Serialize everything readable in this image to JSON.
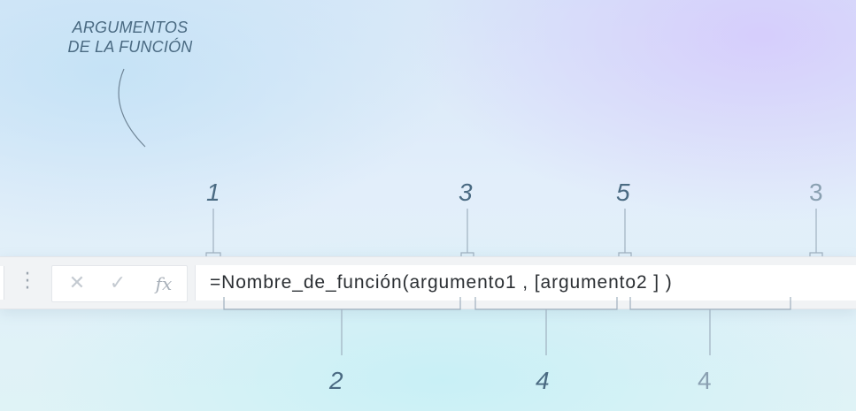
{
  "heading": {
    "line1": "ARGUMENTOS",
    "line2": "DE LA FUNCIÓN"
  },
  "formula_bar": {
    "cancel_icon": "close-icon",
    "cancel_glyph": "✕",
    "enter_icon": "check-icon",
    "enter_glyph": "✓",
    "fx_label": "fx",
    "grip_icon": "vertical-ellipsis-icon",
    "formula": "=Nombre_de_función(argumento1 , [argumento2 ] )"
  },
  "callouts": {
    "top": [
      "1",
      "3",
      "5",
      "3"
    ],
    "bottom": [
      "2",
      "4",
      "4"
    ]
  },
  "colors": {
    "label": "#4a6a82",
    "label_light": "#8aa0b1",
    "bracket": "#9fb0bf",
    "formula_text": "#2b2f33"
  }
}
